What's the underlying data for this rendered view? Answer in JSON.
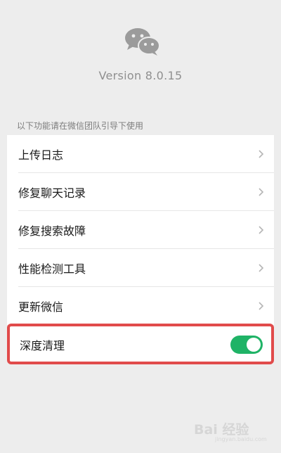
{
  "about": {
    "version": "Version 8.0.15"
  },
  "section_label": "以下功能请在微信团队引导下使用",
  "items": [
    {
      "label": "上传日志"
    },
    {
      "label": "修复聊天记录"
    },
    {
      "label": "修复搜索故障"
    },
    {
      "label": "性能检测工具"
    },
    {
      "label": "更新微信"
    }
  ],
  "deep_clean": {
    "label": "深度清理",
    "enabled": true
  },
  "watermark": {
    "text": "Bai 经验",
    "sub": "jingyan.baidu.com"
  },
  "colors": {
    "accent_green": "#1fb366",
    "highlight_red": "#e14b4b",
    "background": "#ededed"
  }
}
